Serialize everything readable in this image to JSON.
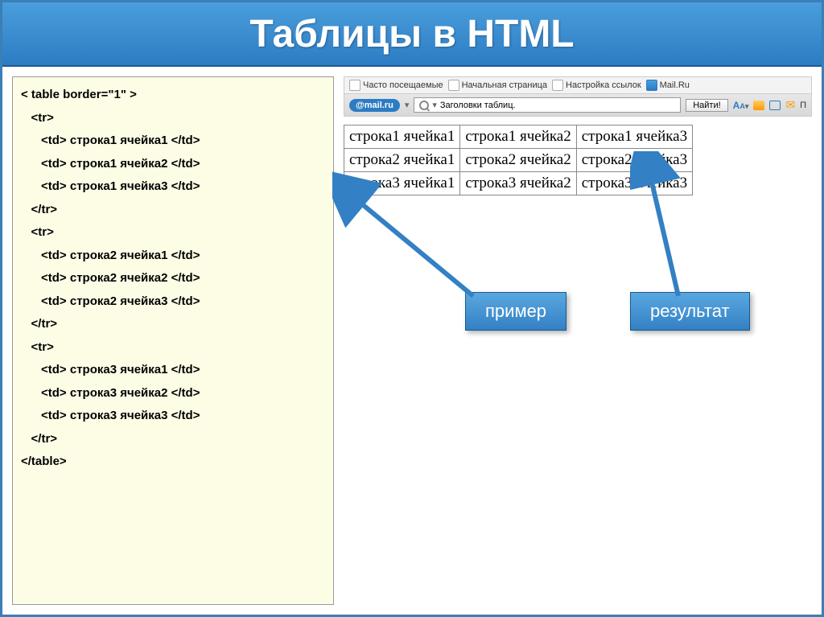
{
  "title": "Таблицы в HTML",
  "code": {
    "open_table": "< table border=\"1\" >",
    "open_tr": "<tr>",
    "close_tr": "</tr>",
    "close_table": "</table>",
    "cells": [
      [
        "<td> строка1 ячейка1 </td>",
        "<td> строка1 ячейка2 </td>",
        "<td> строка1 ячейка3 </td>"
      ],
      [
        "<td> строка2 ячейка1 </td>",
        "<td> строка2 ячейка2 </td>",
        "<td> строка2 ячейка3 </td>"
      ],
      [
        "<td> строка3 ячейка1 </td>",
        "<td> строка3 ячейка2 </td>",
        "<td> строка3 ячейка3 </td>"
      ]
    ]
  },
  "browser": {
    "bookmarks": {
      "frequent": "Часто посещаемые",
      "startpage": "Начальная страница",
      "links": "Настройка ссылок",
      "mail": "Mail.Ru"
    },
    "searchbar": {
      "logo_at": "@",
      "logo_text": "mail.ru",
      "search_value": "Заголовки таблиц.",
      "find_btn": "Найти!",
      "aa": "A",
      "aa_small": "A",
      "po_label": "П"
    }
  },
  "result_table": [
    [
      "строка1 ячейка1",
      "строка1 ячейка2",
      "строка1 ячейка3"
    ],
    [
      "строка2 ячейка1",
      "строка2 ячейка2",
      "строка2 ячейка3"
    ],
    [
      "строка3 ячейка1",
      "строка3 ячейка2",
      "строка3 ячейка3"
    ]
  ],
  "labels": {
    "example": "пример",
    "result": "результат"
  }
}
